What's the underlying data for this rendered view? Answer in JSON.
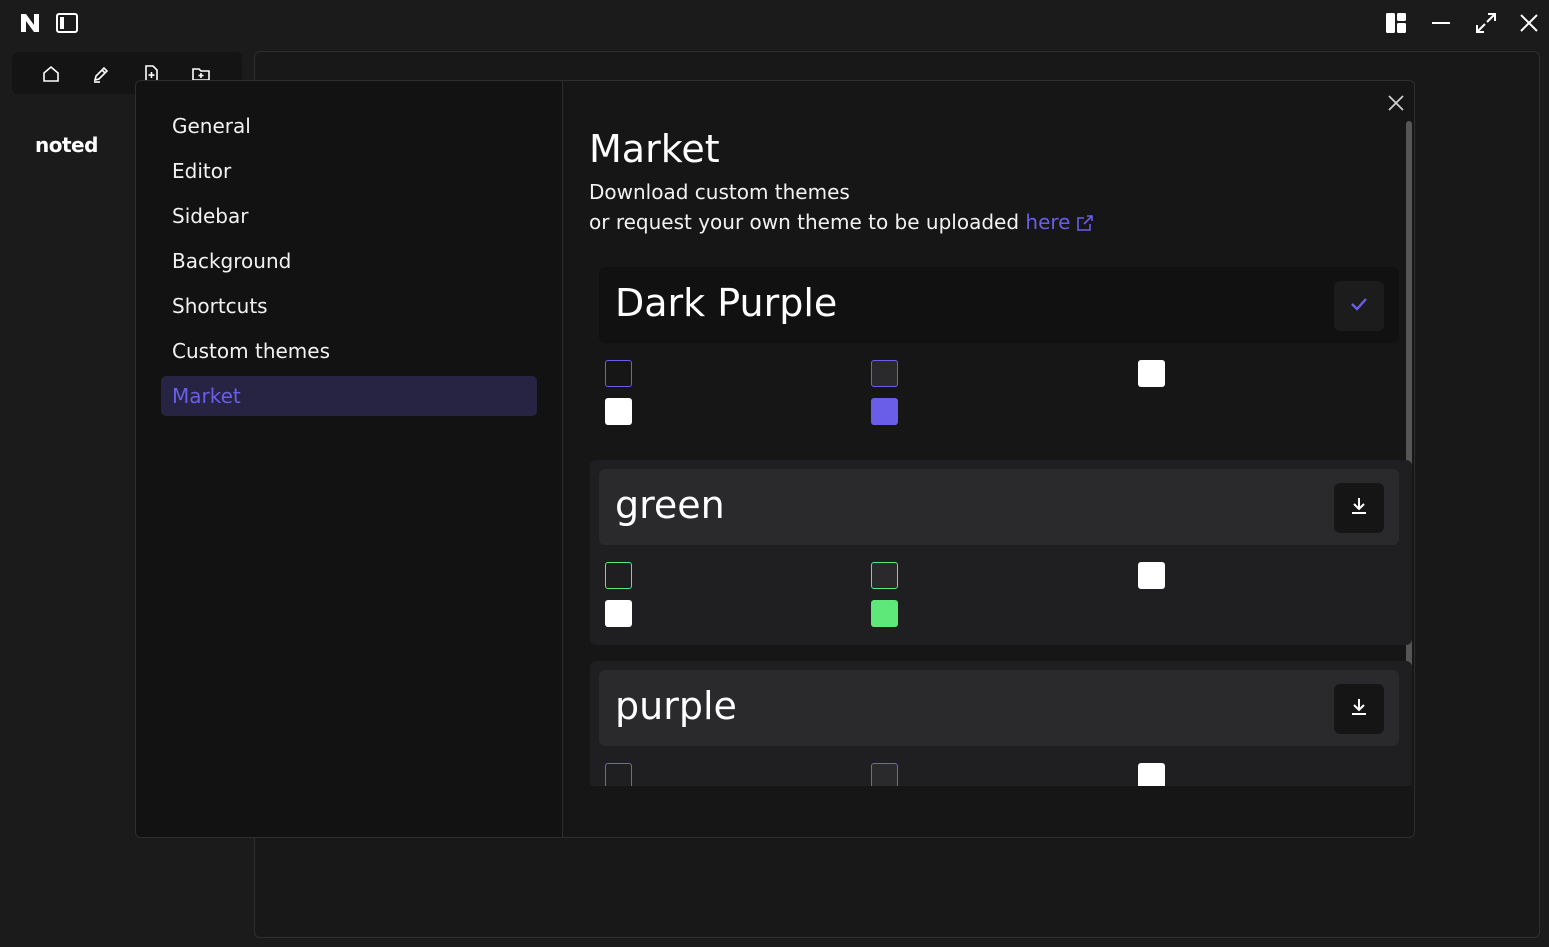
{
  "app": {
    "logo_icon": "n-logo-icon",
    "brand": "noted",
    "toolbar": [
      {
        "icon": "home-icon"
      },
      {
        "icon": "edit-icon"
      },
      {
        "icon": "new-file-icon"
      },
      {
        "icon": "new-folder-icon"
      }
    ]
  },
  "window_controls": [
    "layout-icon",
    "minimize-icon",
    "maximize-icon",
    "close-icon"
  ],
  "settings": {
    "nav": [
      "General",
      "Editor",
      "Sidebar",
      "Background",
      "Shortcuts",
      "Custom themes",
      "Market"
    ],
    "active": "Market",
    "accent_color": "#6a5ee8"
  },
  "market": {
    "title": "Market",
    "subtitle_line1": "Download custom themes",
    "subtitle_line2": "or request your own theme to be uploaded",
    "link_text": "here",
    "themes": [
      {
        "name": "Dark Purple",
        "action": "check-icon",
        "installed": true,
        "colors": [
          "#6a5ee8",
          "#6a5ee8",
          "#ffffff",
          "#ffffff",
          "#6a5ee8"
        ]
      },
      {
        "name": "green",
        "action": "download-icon",
        "installed": false,
        "colors": [
          "#5ee87a",
          "#5ee87a",
          "#ffffff",
          "#ffffff",
          "#5ee87a"
        ]
      },
      {
        "name": "purple",
        "action": "download-icon",
        "installed": false,
        "colors": [
          "#6a5ee8",
          "#6a5ee8",
          "#ffffff"
        ]
      }
    ]
  }
}
